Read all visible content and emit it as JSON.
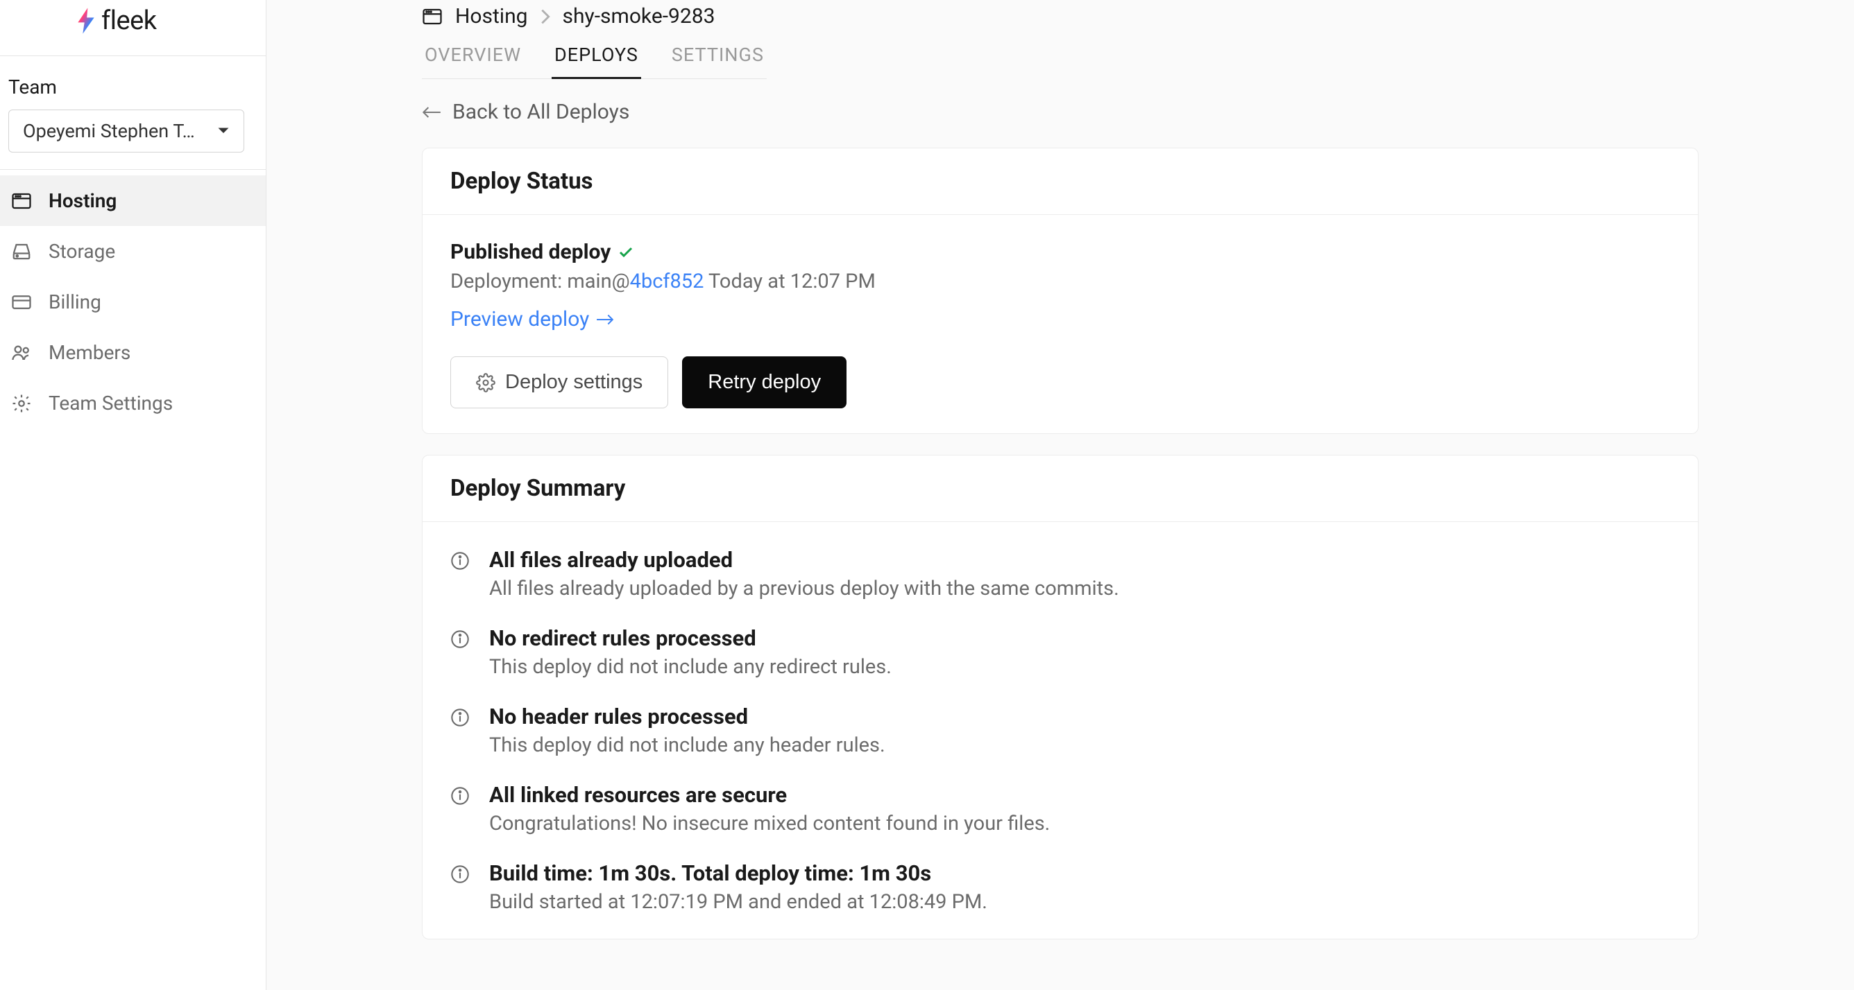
{
  "brand": "fleek",
  "sidebar": {
    "team_label": "Team",
    "team_name": "Opeyemi Stephen T…",
    "items": [
      {
        "label": "Hosting",
        "icon": "browser-icon",
        "active": true
      },
      {
        "label": "Storage",
        "icon": "drive-icon",
        "active": false
      },
      {
        "label": "Billing",
        "icon": "card-icon",
        "active": false
      },
      {
        "label": "Members",
        "icon": "users-icon",
        "active": false
      },
      {
        "label": "Team Settings",
        "icon": "gear-icon",
        "active": false
      }
    ]
  },
  "breadcrumb": {
    "root": "Hosting",
    "leaf": "shy-smoke-9283"
  },
  "tabs": [
    {
      "label": "OVERVIEW",
      "active": false
    },
    {
      "label": "DEPLOYS",
      "active": true
    },
    {
      "label": "SETTINGS",
      "active": false
    }
  ],
  "back_link": "Back to All Deploys",
  "deploy_status": {
    "card_title": "Deploy Status",
    "title": "Published deploy",
    "meta_prefix": "Deployment: main@",
    "commit": "4bcf852",
    "meta_suffix": "  Today at 12:07 PM",
    "preview_label": "Preview deploy",
    "settings_btn": "Deploy settings",
    "retry_btn": "Retry deploy"
  },
  "deploy_summary": {
    "card_title": "Deploy Summary",
    "items": [
      {
        "title": "All files already uploaded",
        "desc": "All files already uploaded by a previous deploy with the same commits."
      },
      {
        "title": "No redirect rules processed",
        "desc": "This deploy did not include any redirect rules."
      },
      {
        "title": "No header rules processed",
        "desc": "This deploy did not include any header rules."
      },
      {
        "title": "All linked resources are secure",
        "desc": "Congratulations! No insecure mixed content found in your files."
      },
      {
        "title": "Build time: 1m 30s. Total deploy time: 1m 30s",
        "desc": "Build started at 12:07:19 PM and ended at 12:08:49 PM."
      }
    ]
  }
}
